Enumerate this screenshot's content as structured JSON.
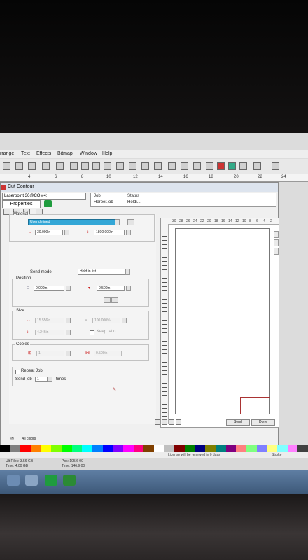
{
  "menu": [
    "rrange",
    "Text",
    "Effects",
    "Bitmap",
    "Window",
    "Help"
  ],
  "ruler_ticks": [
    "4",
    "6",
    "8",
    "10",
    "12",
    "14",
    "16",
    "18",
    "20",
    "22",
    "24"
  ],
  "dialog": {
    "title": "Cut Contour",
    "device": "Laserpoint 36@COM4:",
    "tab_properties": "Properties",
    "job_header": {
      "job": "Job",
      "status": "Status"
    },
    "job_row": {
      "job": "Harper.job",
      "status": "Holdi..."
    },
    "material": {
      "label": "Material",
      "selected": "User defined",
      "width": "30.000in",
      "length": "1800.000in"
    },
    "send_mode": {
      "label": "Send mode:",
      "value": "Hold in list"
    },
    "position": {
      "label": "Position",
      "x": "0.000in",
      "y": "0.500in"
    },
    "size": {
      "label": "Size",
      "width": "15.556in",
      "height": "4.246in",
      "scale": "100.000%",
      "keep_ratio": "Keep ratio"
    },
    "copies": {
      "label": "Copies",
      "count": "1",
      "spacing": "0.500in"
    },
    "repeat": {
      "label": "Repeat Job",
      "send_job": "Send job",
      "times_value": "1",
      "times": "times"
    },
    "preview_ruler": [
      "30",
      "28",
      "26",
      "24",
      "22",
      "20",
      "18",
      "16",
      "14",
      "12",
      "10",
      "8",
      "6",
      "4",
      "2"
    ],
    "send_label": "Send",
    "done_label": "Done",
    "all_colors": "All colors"
  },
  "status": {
    "license": "License will be renewed in 0 days",
    "right": "Stroke"
  },
  "fileinfo": {
    "file_label": "Ult Files: 3.56 GB",
    "time": "Time: 4:00 GB",
    "pos": "Pos: 105.6 00",
    "pos2": "Time: 146.9 00"
  },
  "colors": {
    "accent": "#33a6d6",
    "palette": [
      "#000000",
      "#7f7f7f",
      "#ff0000",
      "#ff8000",
      "#ffff00",
      "#80ff00",
      "#00ff00",
      "#00ff80",
      "#00ffff",
      "#0080ff",
      "#0000ff",
      "#8000ff",
      "#ff00ff",
      "#ff0080",
      "#804000",
      "#ffffff",
      "#c0c0c0",
      "#800000",
      "#008000",
      "#000080",
      "#808000",
      "#008080",
      "#800080",
      "#ff8080",
      "#80ff80",
      "#8080ff",
      "#ffff80",
      "#80ffff",
      "#ff80ff",
      "#404040"
    ]
  }
}
